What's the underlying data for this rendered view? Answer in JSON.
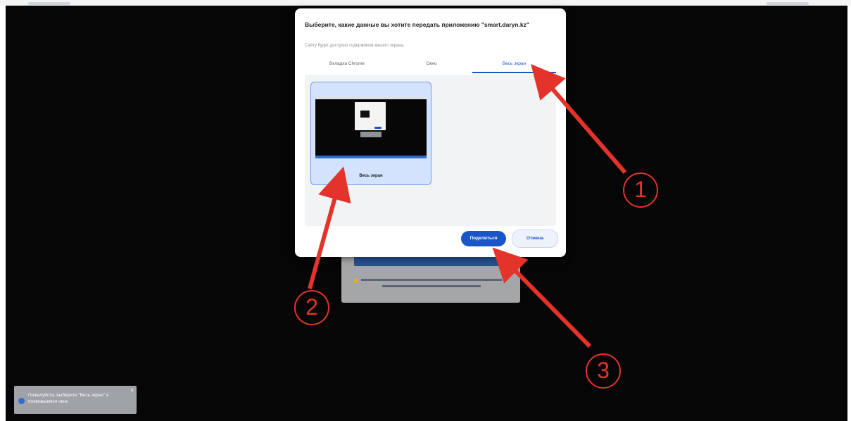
{
  "dialog": {
    "title": "Выберите, какие данные вы хотите передать приложению \"smart.daryn.kz\"",
    "subtitle": "Сайту будет доступно содержимое вашего экрана.",
    "tabs": [
      {
        "label": "Вкладка Chrome",
        "selected": false
      },
      {
        "label": "Окно",
        "selected": false
      },
      {
        "label": "Весь экран",
        "selected": true
      }
    ],
    "screen_option": {
      "label": "Весь экран",
      "selected": true
    },
    "share_button": "Поделиться",
    "cancel_button": "Отмена"
  },
  "notification": {
    "text": "Пожалуйста, выберите \"Весь экран\" в появившемся окне",
    "close": "×"
  },
  "annotations": [
    {
      "number": "1",
      "target": "tab-entire-screen"
    },
    {
      "number": "2",
      "target": "screen-thumbnail-card"
    },
    {
      "number": "3",
      "target": "share-button"
    }
  ],
  "colors": {
    "accent": "#1a56c8",
    "annotation": "#e3332a",
    "screen_bg": "#060606"
  }
}
